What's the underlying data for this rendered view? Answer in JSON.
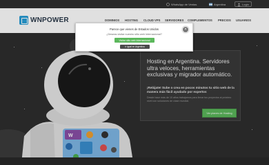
{
  "topbar": {
    "whatsapp_label": "WhatsApp de Ventas",
    "region_label": "Argentina",
    "login_label": "Login"
  },
  "brand": {
    "name": "WNPOWER",
    "accent": "#2a9fd8"
  },
  "nav": {
    "items": [
      "DOMINIOS",
      "HOSTING",
      "CLOUD VPS",
      "SERVIDORES",
      "COMPLEMENTOS",
      "PRECIOS",
      "USUARIOS"
    ]
  },
  "hero": {
    "title": "Hosting en Argentina. Servidores ultra veloces, herramientas exclusivas y migrador automático.",
    "subtitle": "¡Relájate! Sube o crea en pocos minutos tu sitio web de la manera más fácil ayudado por expertos",
    "small_text": "Desde hace más de 10 años trabajamos para llevar tus proyectos al próximo nivel con soluciones de clase mundial.",
    "cta_label": "Ver planes de Hosting",
    "cta_color": "#5cb85c"
  },
  "modal": {
    "title": "Parece que vienes de Estados Unidos",
    "question": "¿Deseas visitar nuestro sitio web Internacional?",
    "primary_label": "Visitar sitio web Internacional",
    "secondary_label": "Ir igual en Argentina",
    "close_label": "×"
  },
  "icons": {
    "whatsapp": "whatsapp-icon",
    "region": "flag-icon",
    "login": "user-icon",
    "close": "close-icon"
  },
  "colors": {
    "background": "#2e2e2e",
    "nav_bg": "#ffffff",
    "primary_green": "#5cb85c"
  }
}
